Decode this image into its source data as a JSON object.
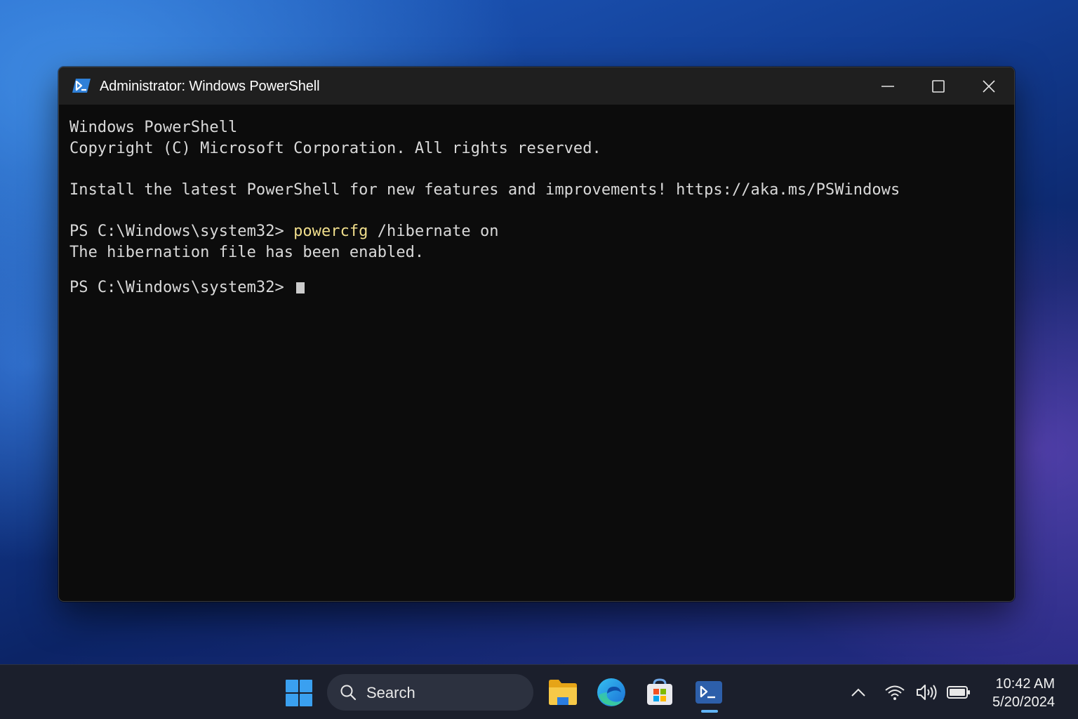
{
  "window": {
    "title": "Administrator: Windows PowerShell",
    "app_icon": "powershell-icon",
    "controls": [
      "minimize-icon",
      "maximize-icon",
      "close-icon"
    ]
  },
  "console": {
    "header_line1": "Windows PowerShell",
    "header_line2": "Copyright (C) Microsoft Corporation. All rights reserved.",
    "install_line": "Install the latest PowerShell for new features and improvements! https://aka.ms/PSWindows",
    "prompt1": "PS C:\\Windows\\system32> ",
    "command_name": "powercfg",
    "command_args": " /hibernate on",
    "output_line": "The hibernation file has been enabled.",
    "prompt2": "PS C:\\Windows\\system32> "
  },
  "taskbar": {
    "search_placeholder": "Search",
    "apps": [
      "windows-start-icon",
      "file-explorer-icon",
      "edge-icon",
      "microsoft-store-icon",
      "powershell-icon"
    ],
    "tray_icons": [
      "chevron-up-icon",
      "wifi-icon",
      "volume-icon",
      "battery-icon"
    ],
    "time": "10:42 AM",
    "date": "5/20/2024"
  },
  "colors": {
    "console_bg": "#0c0c0c",
    "console_text": "#d9d9d9",
    "command_highlight": "#f0de8c",
    "titlebar_bg": "#1f1f1f",
    "taskbar_bg": "#1b1f2c",
    "accent": "#60b3f5"
  }
}
